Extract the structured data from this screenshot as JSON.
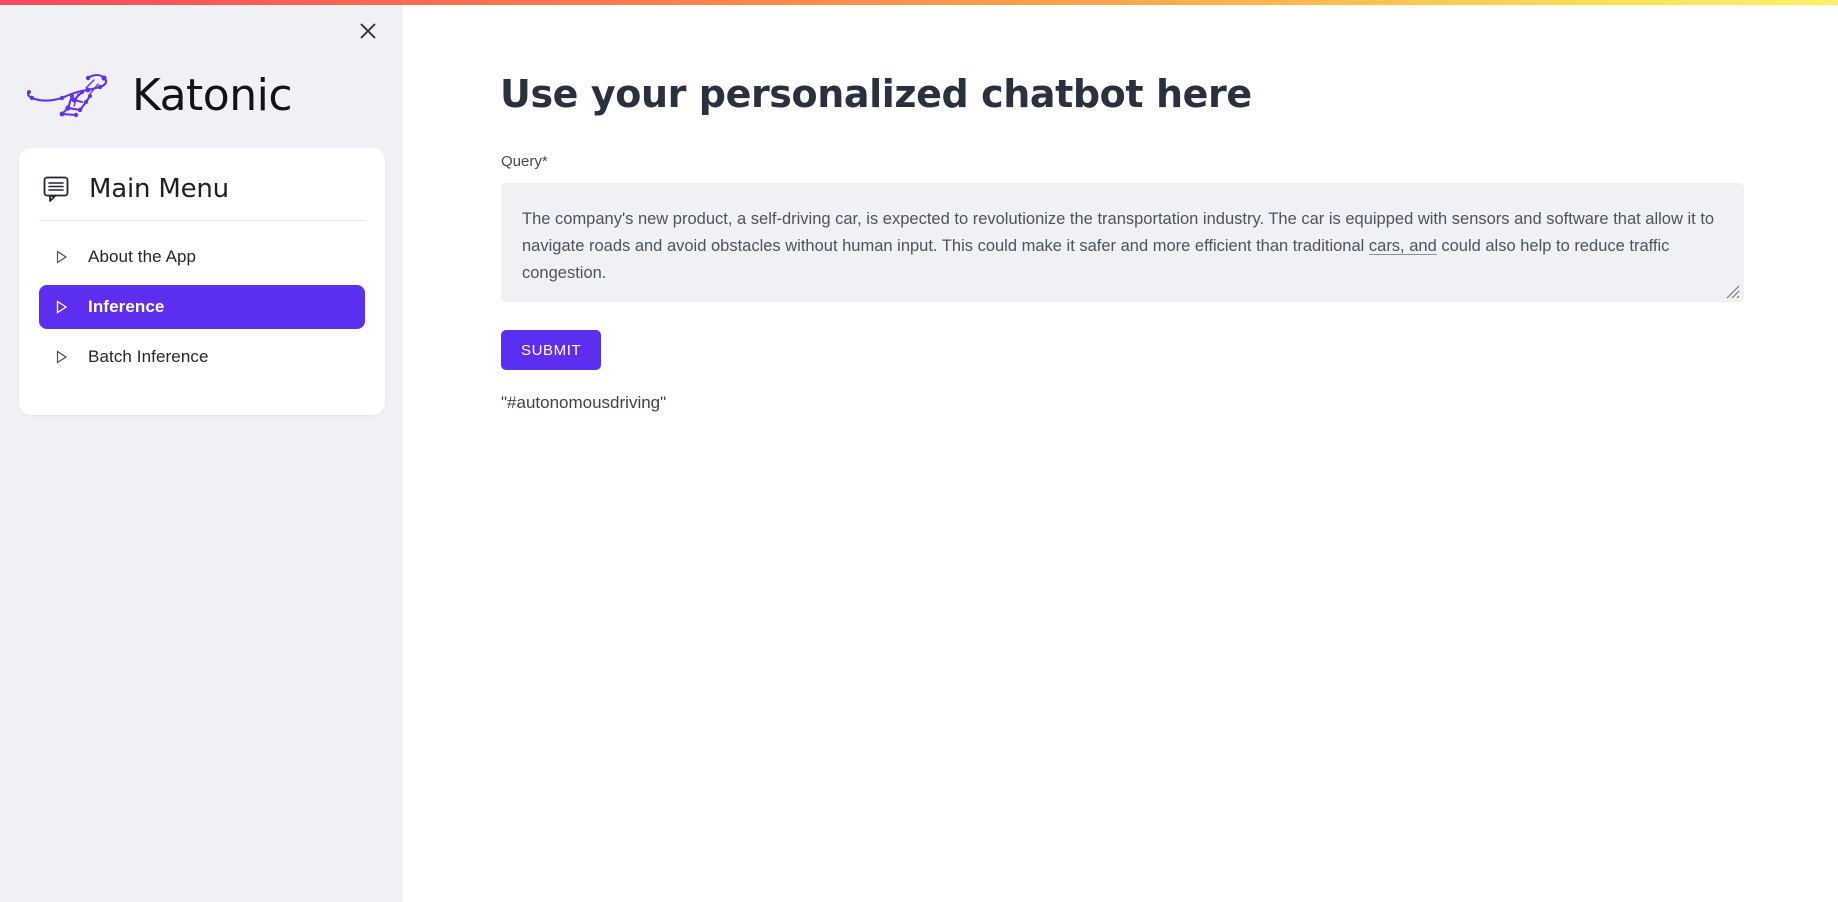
{
  "theme": {
    "accent_purple": "#5b2ef0",
    "sidebar_bg": "#f0f1f5",
    "card_bg": "#ffffff",
    "heading_color": "#29303f",
    "input_bg": "#eff1f4",
    "gradient_start": "#f8485e",
    "gradient_end": "#faf06b"
  },
  "sidebar": {
    "close_icon": "close-icon",
    "logo": {
      "mark_icon": "kangaroo-network-logo-icon",
      "wordmark": "Katonic"
    },
    "menu_card": {
      "header_icon": "chat-menu-icon",
      "title": "Main Menu",
      "items": [
        {
          "label": "About the App",
          "icon": "triangle-right-icon",
          "active": false
        },
        {
          "label": "Inference",
          "icon": "triangle-right-icon",
          "active": true
        },
        {
          "label": "Batch Inference",
          "icon": "triangle-right-icon",
          "active": false
        }
      ]
    }
  },
  "main": {
    "page_title": "Use your personalized chatbot here",
    "query": {
      "label": "Query",
      "required_marker": "*",
      "value": "The company's new product, a self-driving car, is expected to revolutionize the transportation industry. The car is equipped with sensors and software that allow it to navigate roads and avoid obstacles without human input. This could make it safer and more efficient than traditional cars, and could also help to reduce traffic congestion.",
      "placeholder": "",
      "segments": [
        {
          "text": "The company's new product, a self-driving car, is expected to revolutionize the transportation industry. The car is equipped with sensors and software that allow it to navigate roads and avoid obstacles without human input. This could make it safer and more efficient than traditional ",
          "spellcheck_error": false
        },
        {
          "text": "cars, and",
          "spellcheck_error": true
        },
        {
          "text": " could also help to reduce traffic congestion.",
          "spellcheck_error": false
        }
      ],
      "resize_handle_icon": "resize-handle-icon"
    },
    "submit_label": "SUBMIT",
    "result_output": "\"#autonomousdriving\""
  }
}
